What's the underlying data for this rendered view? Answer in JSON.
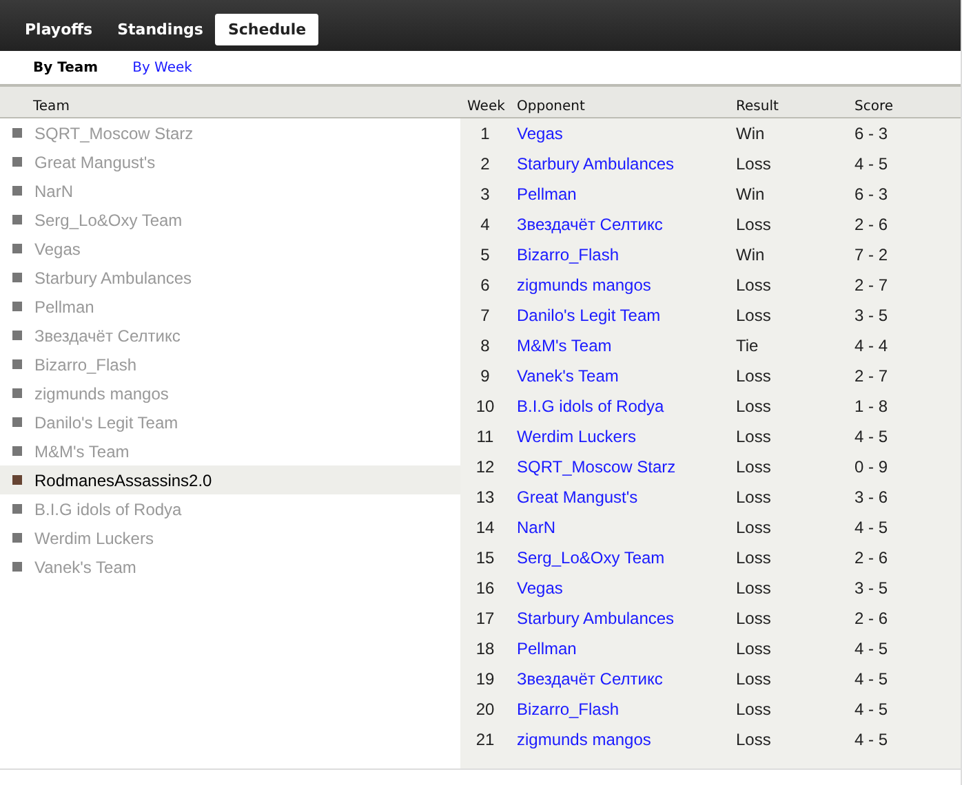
{
  "tabs": [
    {
      "label": "Playoffs",
      "selected": false
    },
    {
      "label": "Standings",
      "selected": false
    },
    {
      "label": "Schedule",
      "selected": true
    }
  ],
  "subtabs": [
    {
      "label": "By Team",
      "selected": true
    },
    {
      "label": "By Week",
      "selected": false
    }
  ],
  "columns": {
    "team": "Team",
    "week": "Week",
    "opponent": "Opponent",
    "result": "Result",
    "score": "Score"
  },
  "teams": [
    {
      "name": "SQRT_Moscow Starz",
      "selected": false
    },
    {
      "name": "Great Mangust's",
      "selected": false
    },
    {
      "name": "NarN",
      "selected": false
    },
    {
      "name": "Serg_Lo&Oxy Team",
      "selected": false
    },
    {
      "name": "Vegas",
      "selected": false
    },
    {
      "name": "Starbury Ambulances",
      "selected": false
    },
    {
      "name": "Pellman",
      "selected": false
    },
    {
      "name": "Звездачёт Селтикс",
      "selected": false
    },
    {
      "name": "Bizarro_Flash",
      "selected": false
    },
    {
      "name": "zigmunds mangos",
      "selected": false
    },
    {
      "name": "Danilo's Legit Team",
      "selected": false
    },
    {
      "name": "M&M's Team",
      "selected": false
    },
    {
      "name": "RodmanesAssassins2.0",
      "selected": true
    },
    {
      "name": "B.I.G idols of Rodya",
      "selected": false
    },
    {
      "name": "Werdim Luckers",
      "selected": false
    },
    {
      "name": "Vanek's Team",
      "selected": false
    }
  ],
  "schedule": [
    {
      "week": "1",
      "opponent": "Vegas",
      "result": "Win",
      "score": "6 - 3"
    },
    {
      "week": "2",
      "opponent": "Starbury Ambulances",
      "result": "Loss",
      "score": "4 - 5"
    },
    {
      "week": "3",
      "opponent": "Pellman",
      "result": "Win",
      "score": "6 - 3"
    },
    {
      "week": "4",
      "opponent": "Звездачёт Селтикс",
      "result": "Loss",
      "score": "2 - 6"
    },
    {
      "week": "5",
      "opponent": "Bizarro_Flash",
      "result": "Win",
      "score": "7 - 2"
    },
    {
      "week": "6",
      "opponent": "zigmunds mangos",
      "result": "Loss",
      "score": "2 - 7"
    },
    {
      "week": "7",
      "opponent": "Danilo's Legit Team",
      "result": "Loss",
      "score": "3 - 5"
    },
    {
      "week": "8",
      "opponent": "M&M's Team",
      "result": "Tie",
      "score": "4 - 4"
    },
    {
      "week": "9",
      "opponent": "Vanek's Team",
      "result": "Loss",
      "score": "2 - 7"
    },
    {
      "week": "10",
      "opponent": "B.I.G idols of Rodya",
      "result": "Loss",
      "score": "1 - 8"
    },
    {
      "week": "11",
      "opponent": "Werdim Luckers",
      "result": "Loss",
      "score": "4 - 5"
    },
    {
      "week": "12",
      "opponent": "SQRT_Moscow Starz",
      "result": "Loss",
      "score": "0 - 9"
    },
    {
      "week": "13",
      "opponent": "Great Mangust's",
      "result": "Loss",
      "score": "3 - 6"
    },
    {
      "week": "14",
      "opponent": "NarN",
      "result": "Loss",
      "score": "4 - 5"
    },
    {
      "week": "15",
      "opponent": "Serg_Lo&Oxy Team",
      "result": "Loss",
      "score": "2 - 6"
    },
    {
      "week": "16",
      "opponent": "Vegas",
      "result": "Loss",
      "score": "3 - 5"
    },
    {
      "week": "17",
      "opponent": "Starbury Ambulances",
      "result": "Loss",
      "score": "2 - 6"
    },
    {
      "week": "18",
      "opponent": "Pellman",
      "result": "Loss",
      "score": "4 - 5"
    },
    {
      "week": "19",
      "opponent": "Звездачёт Селтикс",
      "result": "Loss",
      "score": "4 - 5"
    },
    {
      "week": "20",
      "opponent": "Bizarro_Flash",
      "result": "Loss",
      "score": "4 - 5"
    },
    {
      "week": "21",
      "opponent": "zigmunds mangos",
      "result": "Loss",
      "score": "4 - 5"
    }
  ]
}
